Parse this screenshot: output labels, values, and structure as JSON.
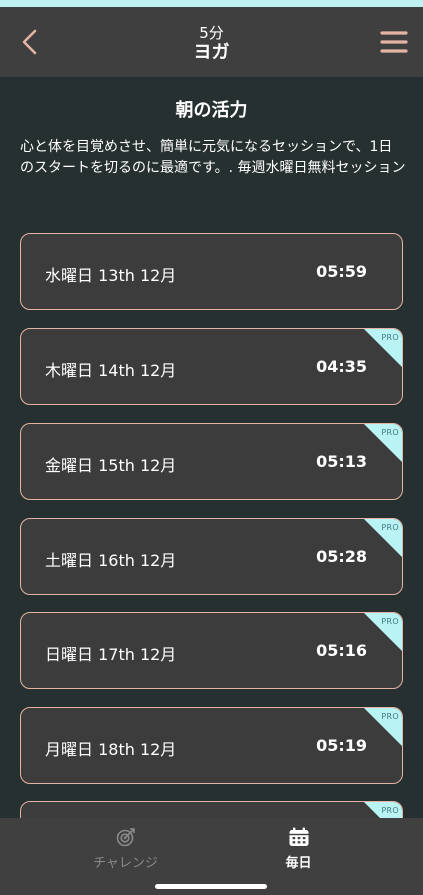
{
  "header": {
    "subtitle": "5分",
    "title": "ヨガ"
  },
  "main": {
    "title": "朝の活力",
    "description": "心と体を目覚めさせ、簡単に元気になるセッションで、1日のスタートを切るのに最適です。. 毎週水曜日無料セッション",
    "pro_badge": "PRO",
    "sessions": [
      {
        "date": "水曜日 13th 12月",
        "time": "05:59",
        "pro": false
      },
      {
        "date": "木曜日 14th 12月",
        "time": "04:35",
        "pro": true
      },
      {
        "date": "金曜日 15th 12月",
        "time": "05:13",
        "pro": true
      },
      {
        "date": "土曜日 16th 12月",
        "time": "05:28",
        "pro": true
      },
      {
        "date": "日曜日 17th 12月",
        "time": "05:16",
        "pro": true
      },
      {
        "date": "月曜日 18th 12月",
        "time": "05:19",
        "pro": true
      },
      {
        "date": "",
        "time": "",
        "pro": true
      }
    ]
  },
  "tabbar": {
    "tabs": [
      {
        "label": "チャレンジ",
        "icon": "target-icon",
        "active": false
      },
      {
        "label": "毎日",
        "icon": "calendar-icon",
        "active": true
      }
    ]
  },
  "colors": {
    "background": "#273030",
    "header": "#3f3f3f",
    "accent": "#e3b4a4",
    "pro_ribbon": "#b9f3f3",
    "status_strip": "#bff1f1"
  }
}
